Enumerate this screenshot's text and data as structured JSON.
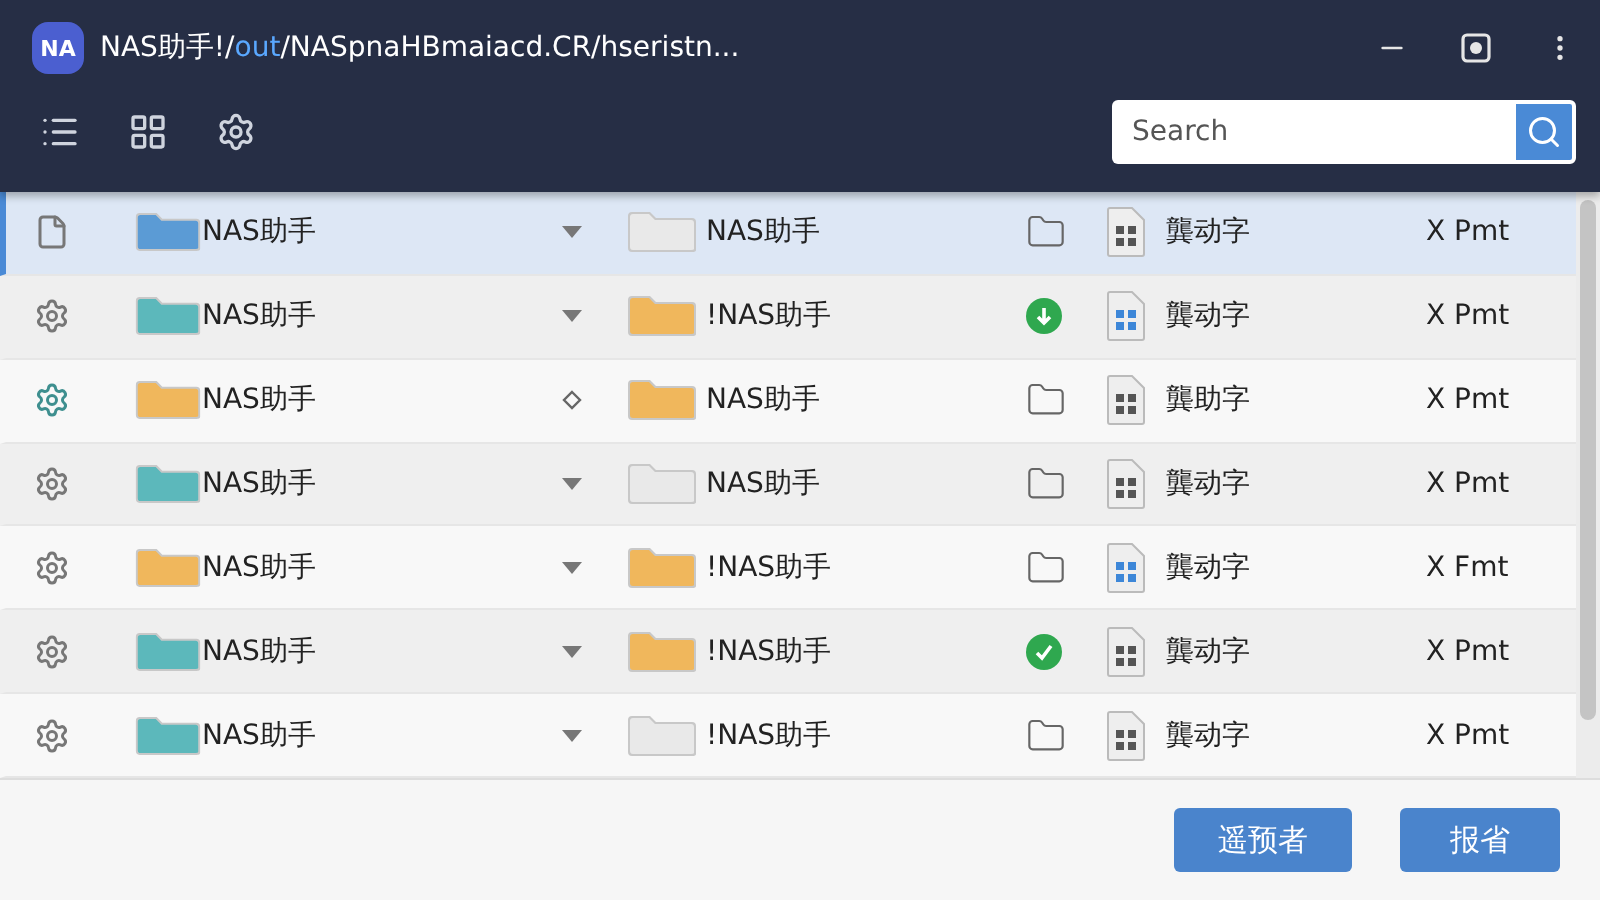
{
  "window": {
    "logo": "NA",
    "title": {
      "prefix": "NAS助手!/",
      "highlight": "out",
      "rest": "/NASpnaHBmaiacd.CR/hseristn..."
    }
  },
  "toolbar": {
    "search": {
      "placeholder": "Search"
    }
  },
  "rows": [
    {
      "selected": true,
      "lead": {
        "kind": "file"
      },
      "folder": {
        "color": "#5b9bd5"
      },
      "name": "NAS助手",
      "caret": {
        "kind": "triangle"
      },
      "folder2": {
        "color": "#e9e9e9"
      },
      "name2": "NAS助手",
      "status": {
        "kind": "folder"
      },
      "doc": {
        "color": "#555555"
      },
      "label": "龔动字",
      "type": "X Pmt"
    },
    {
      "selected": false,
      "lead": {
        "kind": "gear",
        "color": "#777777"
      },
      "folder": {
        "color": "#5cb8bb"
      },
      "name": "NAS助手",
      "caret": {
        "kind": "triangle"
      },
      "folder2": {
        "color": "#f0b75c"
      },
      "name2": "!NAS助手",
      "status": {
        "kind": "download"
      },
      "doc": {
        "color": "#3d87d8"
      },
      "label": "龔动字",
      "type": "X Pmt"
    },
    {
      "selected": false,
      "lead": {
        "kind": "gear",
        "color": "#3e8f8f"
      },
      "folder": {
        "color": "#f0b75c"
      },
      "name": "NAS助手",
      "caret": {
        "kind": "diamond"
      },
      "folder2": {
        "color": "#f0b75c"
      },
      "name2": "NAS助手",
      "status": {
        "kind": "folder"
      },
      "doc": {
        "color": "#555555"
      },
      "label": "龔助字",
      "type": "X Pmt"
    },
    {
      "selected": false,
      "lead": {
        "kind": "gear",
        "color": "#777777"
      },
      "folder": {
        "color": "#5cb8bb"
      },
      "name": "NAS助手",
      "caret": {
        "kind": "triangle"
      },
      "folder2": {
        "color": "#e9e9e9"
      },
      "name2": "NAS助手",
      "status": {
        "kind": "folder"
      },
      "doc": {
        "color": "#555555"
      },
      "label": "龔动字",
      "type": "X Pmt"
    },
    {
      "selected": false,
      "lead": {
        "kind": "gear",
        "color": "#777777"
      },
      "folder": {
        "color": "#f0b75c"
      },
      "name": "NAS助手",
      "caret": {
        "kind": "triangle"
      },
      "folder2": {
        "color": "#f0b75c"
      },
      "name2": "!NAS助手",
      "status": {
        "kind": "folder"
      },
      "doc": {
        "color": "#3d87d8"
      },
      "label": "龔动字",
      "type": "X Fmt"
    },
    {
      "selected": false,
      "lead": {
        "kind": "gear",
        "color": "#777777"
      },
      "folder": {
        "color": "#5cb8bb"
      },
      "name": "NAS助手",
      "caret": {
        "kind": "triangle"
      },
      "folder2": {
        "color": "#f0b75c"
      },
      "name2": "!NAS助手",
      "status": {
        "kind": "check"
      },
      "doc": {
        "color": "#555555"
      },
      "label": "龔动字",
      "type": "X Pmt"
    },
    {
      "selected": false,
      "lead": {
        "kind": "gear",
        "color": "#777777"
      },
      "folder": {
        "color": "#5cb8bb"
      },
      "name": "NAS助手",
      "caret": {
        "kind": "triangle"
      },
      "folder2": {
        "color": "#e9e9e9"
      },
      "name2": "!NAS助手",
      "status": {
        "kind": "folder"
      },
      "doc": {
        "color": "#555555"
      },
      "label": "龔动字",
      "type": "X Pmt"
    }
  ],
  "buttons": [
    "遥预者",
    "报省"
  ]
}
